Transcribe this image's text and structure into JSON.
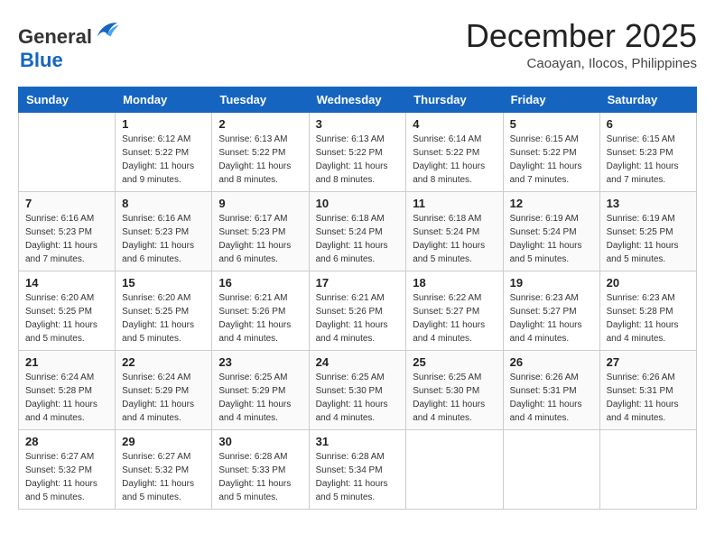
{
  "header": {
    "logo_general": "General",
    "logo_blue": "Blue",
    "month": "December 2025",
    "location": "Caoayan, Ilocos, Philippines"
  },
  "weekdays": [
    "Sunday",
    "Monday",
    "Tuesday",
    "Wednesday",
    "Thursday",
    "Friday",
    "Saturday"
  ],
  "weeks": [
    [
      {
        "day": "",
        "info": ""
      },
      {
        "day": "1",
        "info": "Sunrise: 6:12 AM\nSunset: 5:22 PM\nDaylight: 11 hours\nand 9 minutes."
      },
      {
        "day": "2",
        "info": "Sunrise: 6:13 AM\nSunset: 5:22 PM\nDaylight: 11 hours\nand 8 minutes."
      },
      {
        "day": "3",
        "info": "Sunrise: 6:13 AM\nSunset: 5:22 PM\nDaylight: 11 hours\nand 8 minutes."
      },
      {
        "day": "4",
        "info": "Sunrise: 6:14 AM\nSunset: 5:22 PM\nDaylight: 11 hours\nand 8 minutes."
      },
      {
        "day": "5",
        "info": "Sunrise: 6:15 AM\nSunset: 5:22 PM\nDaylight: 11 hours\nand 7 minutes."
      },
      {
        "day": "6",
        "info": "Sunrise: 6:15 AM\nSunset: 5:23 PM\nDaylight: 11 hours\nand 7 minutes."
      }
    ],
    [
      {
        "day": "7",
        "info": "Sunrise: 6:16 AM\nSunset: 5:23 PM\nDaylight: 11 hours\nand 7 minutes."
      },
      {
        "day": "8",
        "info": "Sunrise: 6:16 AM\nSunset: 5:23 PM\nDaylight: 11 hours\nand 6 minutes."
      },
      {
        "day": "9",
        "info": "Sunrise: 6:17 AM\nSunset: 5:23 PM\nDaylight: 11 hours\nand 6 minutes."
      },
      {
        "day": "10",
        "info": "Sunrise: 6:18 AM\nSunset: 5:24 PM\nDaylight: 11 hours\nand 6 minutes."
      },
      {
        "day": "11",
        "info": "Sunrise: 6:18 AM\nSunset: 5:24 PM\nDaylight: 11 hours\nand 5 minutes."
      },
      {
        "day": "12",
        "info": "Sunrise: 6:19 AM\nSunset: 5:24 PM\nDaylight: 11 hours\nand 5 minutes."
      },
      {
        "day": "13",
        "info": "Sunrise: 6:19 AM\nSunset: 5:25 PM\nDaylight: 11 hours\nand 5 minutes."
      }
    ],
    [
      {
        "day": "14",
        "info": "Sunrise: 6:20 AM\nSunset: 5:25 PM\nDaylight: 11 hours\nand 5 minutes."
      },
      {
        "day": "15",
        "info": "Sunrise: 6:20 AM\nSunset: 5:25 PM\nDaylight: 11 hours\nand 5 minutes."
      },
      {
        "day": "16",
        "info": "Sunrise: 6:21 AM\nSunset: 5:26 PM\nDaylight: 11 hours\nand 4 minutes."
      },
      {
        "day": "17",
        "info": "Sunrise: 6:21 AM\nSunset: 5:26 PM\nDaylight: 11 hours\nand 4 minutes."
      },
      {
        "day": "18",
        "info": "Sunrise: 6:22 AM\nSunset: 5:27 PM\nDaylight: 11 hours\nand 4 minutes."
      },
      {
        "day": "19",
        "info": "Sunrise: 6:23 AM\nSunset: 5:27 PM\nDaylight: 11 hours\nand 4 minutes."
      },
      {
        "day": "20",
        "info": "Sunrise: 6:23 AM\nSunset: 5:28 PM\nDaylight: 11 hours\nand 4 minutes."
      }
    ],
    [
      {
        "day": "21",
        "info": "Sunrise: 6:24 AM\nSunset: 5:28 PM\nDaylight: 11 hours\nand 4 minutes."
      },
      {
        "day": "22",
        "info": "Sunrise: 6:24 AM\nSunset: 5:29 PM\nDaylight: 11 hours\nand 4 minutes."
      },
      {
        "day": "23",
        "info": "Sunrise: 6:25 AM\nSunset: 5:29 PM\nDaylight: 11 hours\nand 4 minutes."
      },
      {
        "day": "24",
        "info": "Sunrise: 6:25 AM\nSunset: 5:30 PM\nDaylight: 11 hours\nand 4 minutes."
      },
      {
        "day": "25",
        "info": "Sunrise: 6:25 AM\nSunset: 5:30 PM\nDaylight: 11 hours\nand 4 minutes."
      },
      {
        "day": "26",
        "info": "Sunrise: 6:26 AM\nSunset: 5:31 PM\nDaylight: 11 hours\nand 4 minutes."
      },
      {
        "day": "27",
        "info": "Sunrise: 6:26 AM\nSunset: 5:31 PM\nDaylight: 11 hours\nand 4 minutes."
      }
    ],
    [
      {
        "day": "28",
        "info": "Sunrise: 6:27 AM\nSunset: 5:32 PM\nDaylight: 11 hours\nand 5 minutes."
      },
      {
        "day": "29",
        "info": "Sunrise: 6:27 AM\nSunset: 5:32 PM\nDaylight: 11 hours\nand 5 minutes."
      },
      {
        "day": "30",
        "info": "Sunrise: 6:28 AM\nSunset: 5:33 PM\nDaylight: 11 hours\nand 5 minutes."
      },
      {
        "day": "31",
        "info": "Sunrise: 6:28 AM\nSunset: 5:34 PM\nDaylight: 11 hours\nand 5 minutes."
      },
      {
        "day": "",
        "info": ""
      },
      {
        "day": "",
        "info": ""
      },
      {
        "day": "",
        "info": ""
      }
    ]
  ]
}
